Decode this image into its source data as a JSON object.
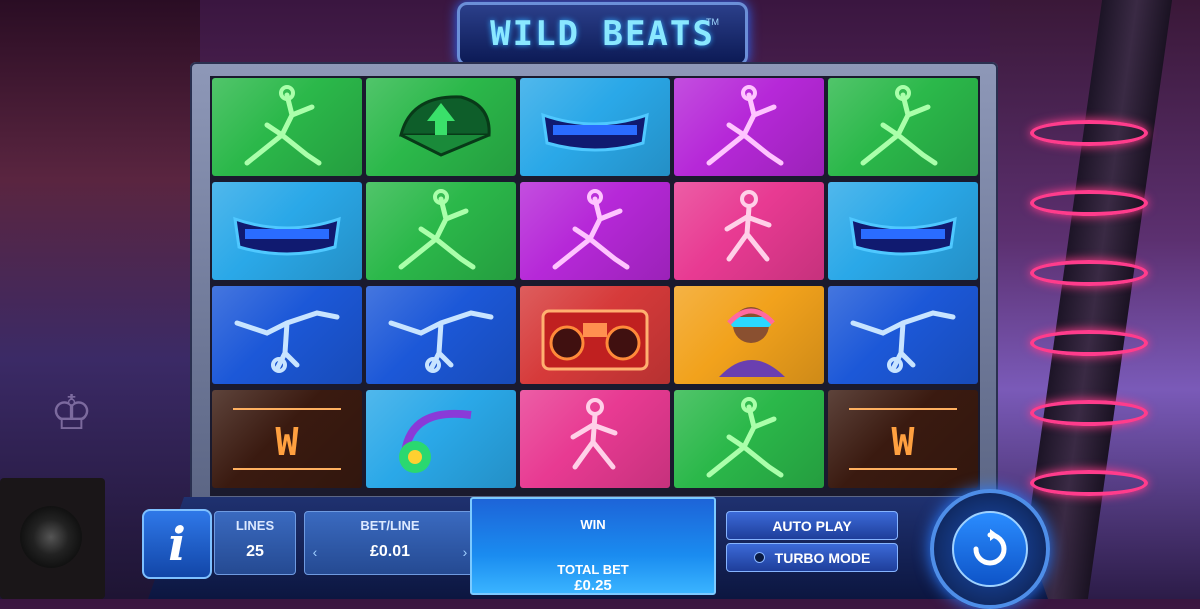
{
  "game": {
    "logo_text": "WILD BEATS",
    "logo_tm": "TM"
  },
  "reels": {
    "rows": [
      [
        "breakdancer-green",
        "cap-green",
        "glasses-blue",
        "breakdancer-magenta",
        "breakdancer-green"
      ],
      [
        "glasses-blue",
        "breakdancer-green",
        "breakdancer-magenta",
        "dancer-pink",
        "glasses-blue"
      ],
      [
        "breakdancer-blue",
        "breakdancer-blue",
        "boombox",
        "dj-character",
        "breakdancer-blue"
      ],
      [
        "wild",
        "headphones",
        "dancer-pink",
        "breakdancer-green",
        "wild"
      ]
    ]
  },
  "controls": {
    "info_label": "i",
    "lines_label": "LINES",
    "lines_value": "25",
    "bet_line_label": "BET/LINE",
    "bet_line_value": "£0.01",
    "prev_icon": "chevron-left-icon",
    "next_icon": "chevron-right-icon",
    "win_label": "WIN",
    "total_bet_label": "TOTAL BET",
    "total_bet_value": "£0.25",
    "auto_play_label": "AUTO PLAY",
    "turbo_mode_label": "TURBO MODE",
    "spin_icon": "spin-arrow-icon"
  },
  "colors": {
    "neon_green": "#2bb84a",
    "neon_blue": "#1c58d8",
    "neon_magenta": "#b628d8",
    "neon_pink": "#e83a92",
    "panel_blue": "#1f3170"
  }
}
